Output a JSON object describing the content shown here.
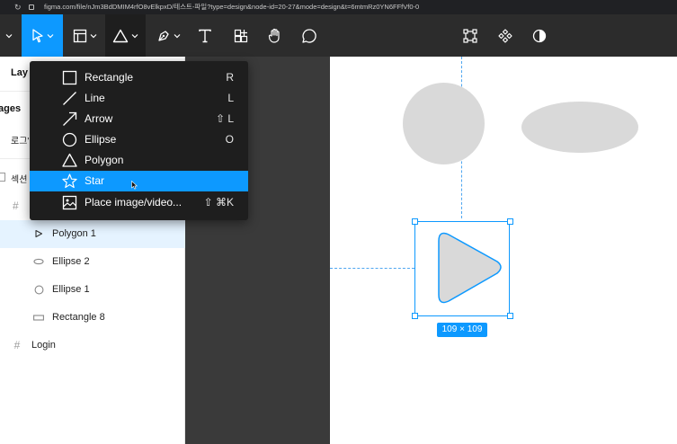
{
  "browser": {
    "url": "figma.com/file/nJm3BdDMIM4rfO8vElkpxD/테스트-파일?type=design&node-id=20-27&mode=design&t=6mtmRz0YN6FFfVf0-0"
  },
  "toolbar": {
    "tools": [
      {
        "name": "move",
        "icon": "move-arrow-icon",
        "active": true
      },
      {
        "name": "frame",
        "icon": "frame-icon",
        "active": false
      },
      {
        "name": "shape",
        "icon": "triangle-icon",
        "active": true
      },
      {
        "name": "pen",
        "icon": "pen-icon",
        "active": false
      },
      {
        "name": "text",
        "icon": "text-icon",
        "active": false
      },
      {
        "name": "resources",
        "icon": "resources-icon",
        "active": false
      },
      {
        "name": "hand",
        "icon": "hand-icon",
        "active": false
      },
      {
        "name": "comment",
        "icon": "comment-icon",
        "active": false
      }
    ],
    "right_tools": [
      "crop-icon",
      "component-icon",
      "contrast-icon"
    ]
  },
  "shape_menu": {
    "items": [
      {
        "label": "Rectangle",
        "shortcut": "R",
        "icon": "rectangle-icon",
        "highlighted": false
      },
      {
        "label": "Line",
        "shortcut": "L",
        "icon": "line-icon",
        "highlighted": false
      },
      {
        "label": "Arrow",
        "shortcut": "⇧ L",
        "icon": "arrow-icon",
        "highlighted": false
      },
      {
        "label": "Ellipse",
        "shortcut": "O",
        "icon": "ellipse-icon",
        "highlighted": false
      },
      {
        "label": "Polygon",
        "shortcut": "",
        "icon": "polygon-icon",
        "highlighted": false
      },
      {
        "label": "Star",
        "shortcut": "",
        "icon": "star-icon",
        "highlighted": true
      },
      {
        "label": "Place image/video...",
        "shortcut": "⇧ ⌘K",
        "icon": "image-icon",
        "highlighted": false
      }
    ]
  },
  "layers_panel": {
    "title": "Lay",
    "pages_label": "ages",
    "page_item": "로그'",
    "section_label": "섹션",
    "layers": [
      {
        "label": "Polygon 1",
        "icon": "polygon-play-icon",
        "selected": true
      },
      {
        "label": "Ellipse 2",
        "icon": "ellipse-outline-icon",
        "selected": false
      },
      {
        "label": "Ellipse 1",
        "icon": "circle-outline-icon",
        "selected": false
      },
      {
        "label": "Rectangle 8",
        "icon": "rectangle-outline-icon",
        "selected": false
      },
      {
        "label": "Login",
        "icon": "frame-hash-icon",
        "selected": false
      }
    ]
  },
  "canvas": {
    "selection_size": "109 × 109",
    "colors": {
      "selection": "#0d99ff",
      "shape_fill": "#d9d9d9",
      "toolbar_bg": "#2c2c2c",
      "menu_bg": "#1e1e1e"
    }
  }
}
